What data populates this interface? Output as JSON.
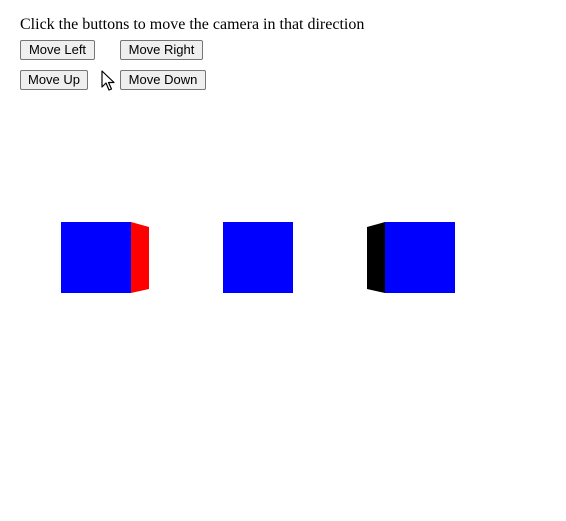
{
  "instructions": "Click the buttons to move the camera in that direction",
  "controls": {
    "move_left_label": "Move Left",
    "move_right_label": "Move Right",
    "move_up_label": "Move Up",
    "move_down_label": "Move Down"
  },
  "cursor": {
    "icon": "arrow-cursor-icon"
  },
  "scene": {
    "cube_count": 3,
    "colors": {
      "front_face": "#0000ff",
      "right_side_face": "#ff0000",
      "left_side_face": "#000000",
      "background": "#ffffff"
    },
    "cubes": [
      {
        "name": "left-cube",
        "visible_side": "right"
      },
      {
        "name": "center-cube",
        "visible_side": "none"
      },
      {
        "name": "right-cube",
        "visible_side": "left"
      }
    ]
  }
}
